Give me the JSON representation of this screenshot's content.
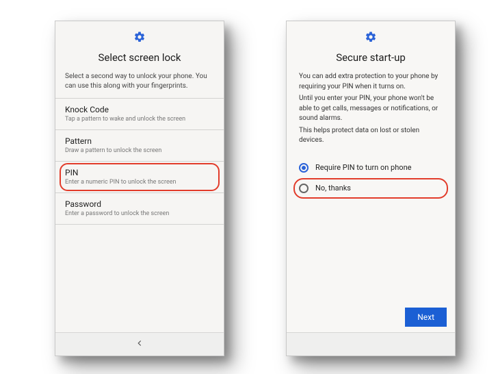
{
  "left": {
    "title": "Select screen lock",
    "subtitle": "Select a second way to unlock your phone. You can use this along with your fingerprints.",
    "options": [
      {
        "label": "Knock Code",
        "desc": "Tap a pattern to wake and unlock the screen"
      },
      {
        "label": "Pattern",
        "desc": "Draw a pattern to unlock the screen"
      },
      {
        "label": "PIN",
        "desc": "Enter a numeric PIN to unlock the screen"
      },
      {
        "label": "Password",
        "desc": "Enter a password to unlock the screen"
      }
    ],
    "highlight_index": 2
  },
  "right": {
    "title": "Secure start-up",
    "paragraphs": [
      "You can add extra protection to your phone by requiring your PIN when it turns on.",
      "Until you enter your PIN, your phone won't be able to get calls, messages or notifications, or sound alarms.",
      "This helps protect data on lost or stolen devices."
    ],
    "options": [
      {
        "label": "Require PIN to turn on phone",
        "selected": true
      },
      {
        "label": "No, thanks",
        "selected": false
      }
    ],
    "highlight_index": 1,
    "next_label": "Next"
  },
  "colors": {
    "accent": "#1b5fd4",
    "highlight": "#e23b2a"
  }
}
